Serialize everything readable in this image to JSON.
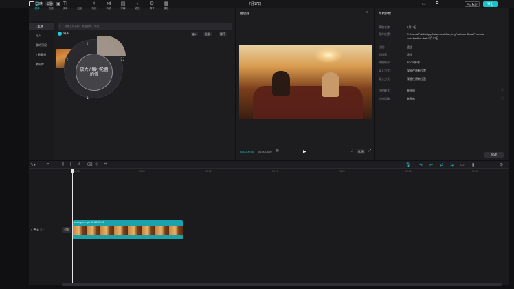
{
  "titlebar": {
    "app_name": "剪映",
    "menu": "菜单",
    "project_title": "7月17日",
    "pro_label": "Pro 标识",
    "export": "导出"
  },
  "media_toolbar": [
    {
      "label": "媒体",
      "icon": "media-icon"
    },
    {
      "label": "音频",
      "icon": "audio-icon"
    },
    {
      "label": "文本",
      "icon": "text-icon"
    },
    {
      "label": "贴纸",
      "icon": "sticker-icon"
    },
    {
      "label": "特效",
      "icon": "effect-icon"
    },
    {
      "label": "转场",
      "icon": "transition-icon"
    },
    {
      "label": "字幕",
      "icon": "caption-icon"
    },
    {
      "label": "滤镜",
      "icon": "filter-icon"
    },
    {
      "label": "调节",
      "icon": "adjust-icon"
    },
    {
      "label": "模板",
      "icon": "template-icon"
    }
  ],
  "media_side": [
    "• 本地",
    "导入",
    "我的预设",
    "▸ 云素材",
    "素材库"
  ],
  "search_placeholder": "搜索文件名称、歌曲名称、标签",
  "import_label": "导入",
  "filter_labels": [
    "全部",
    "排序"
  ],
  "dial_text": "放大 / 缩小轮盘 的值",
  "player": {
    "title": "播放器",
    "current_time": "00:00:00:00",
    "total_time": "00:00:05:07",
    "ratio_label": "比例"
  },
  "details": {
    "title": "草稿参数",
    "rows": [
      {
        "label": "草稿名称：",
        "value": "7月17日"
      },
      {
        "label": "保存位置：",
        "value": "C:/Users/Public/AppData/Local/JianyingPro/User Data/Projects/"
      },
      {
        "label": "",
        "value": "com.lveditor.draft/7月17日"
      },
      {
        "label": "比例：",
        "value": "适应"
      },
      {
        "label": "分辨率：",
        "value": "适应"
      },
      {
        "label": "草稿帧率：",
        "value": "30.00帧/秒"
      },
      {
        "label": "导入方式：",
        "value": "保留在原有位置"
      },
      {
        "label": "代理模式：",
        "value": "未开启"
      },
      {
        "label": "自由层级：",
        "value": "未开启"
      }
    ],
    "modify": "修改"
  },
  "timeline": {
    "ruler": [
      "00:00",
      "00:05",
      "00:10",
      "00:15",
      "00:20",
      "00:25",
      "00:30"
    ],
    "clip_label": "example.mp4  00:00:05:07",
    "cover": "封面"
  }
}
